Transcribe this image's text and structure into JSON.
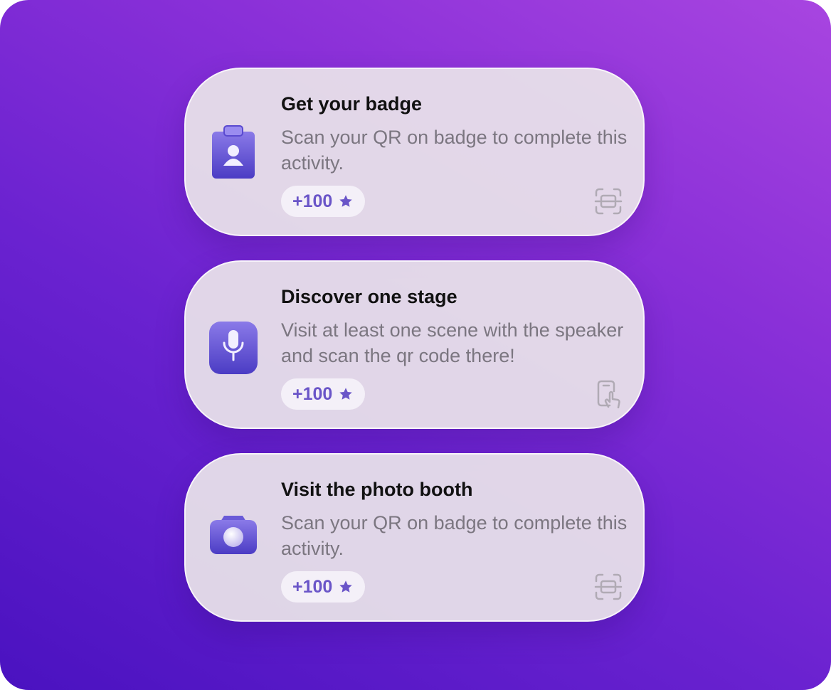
{
  "activities": [
    {
      "title": "Get your badge",
      "description": "Scan your QR on badge to complete this activity.",
      "points": "+100",
      "icon": "id-badge-icon",
      "action_icon": "qr-scan-icon"
    },
    {
      "title": "Discover one stage",
      "description": "Visit at least one scene with the speaker and scan the qr code there!",
      "points": "+100",
      "icon": "microphone-icon",
      "action_icon": "phone-tap-icon"
    },
    {
      "title": "Visit the photo booth",
      "description": "Scan your QR on badge to complete this activity.",
      "points": "+100",
      "icon": "camera-icon",
      "action_icon": "qr-scan-icon"
    }
  ],
  "colors": {
    "accent": "#6a55c8",
    "background_start": "#4a12c0",
    "background_end": "#a845e0",
    "card": "#eae4ea",
    "title": "#111111",
    "description": "#7b7680"
  }
}
